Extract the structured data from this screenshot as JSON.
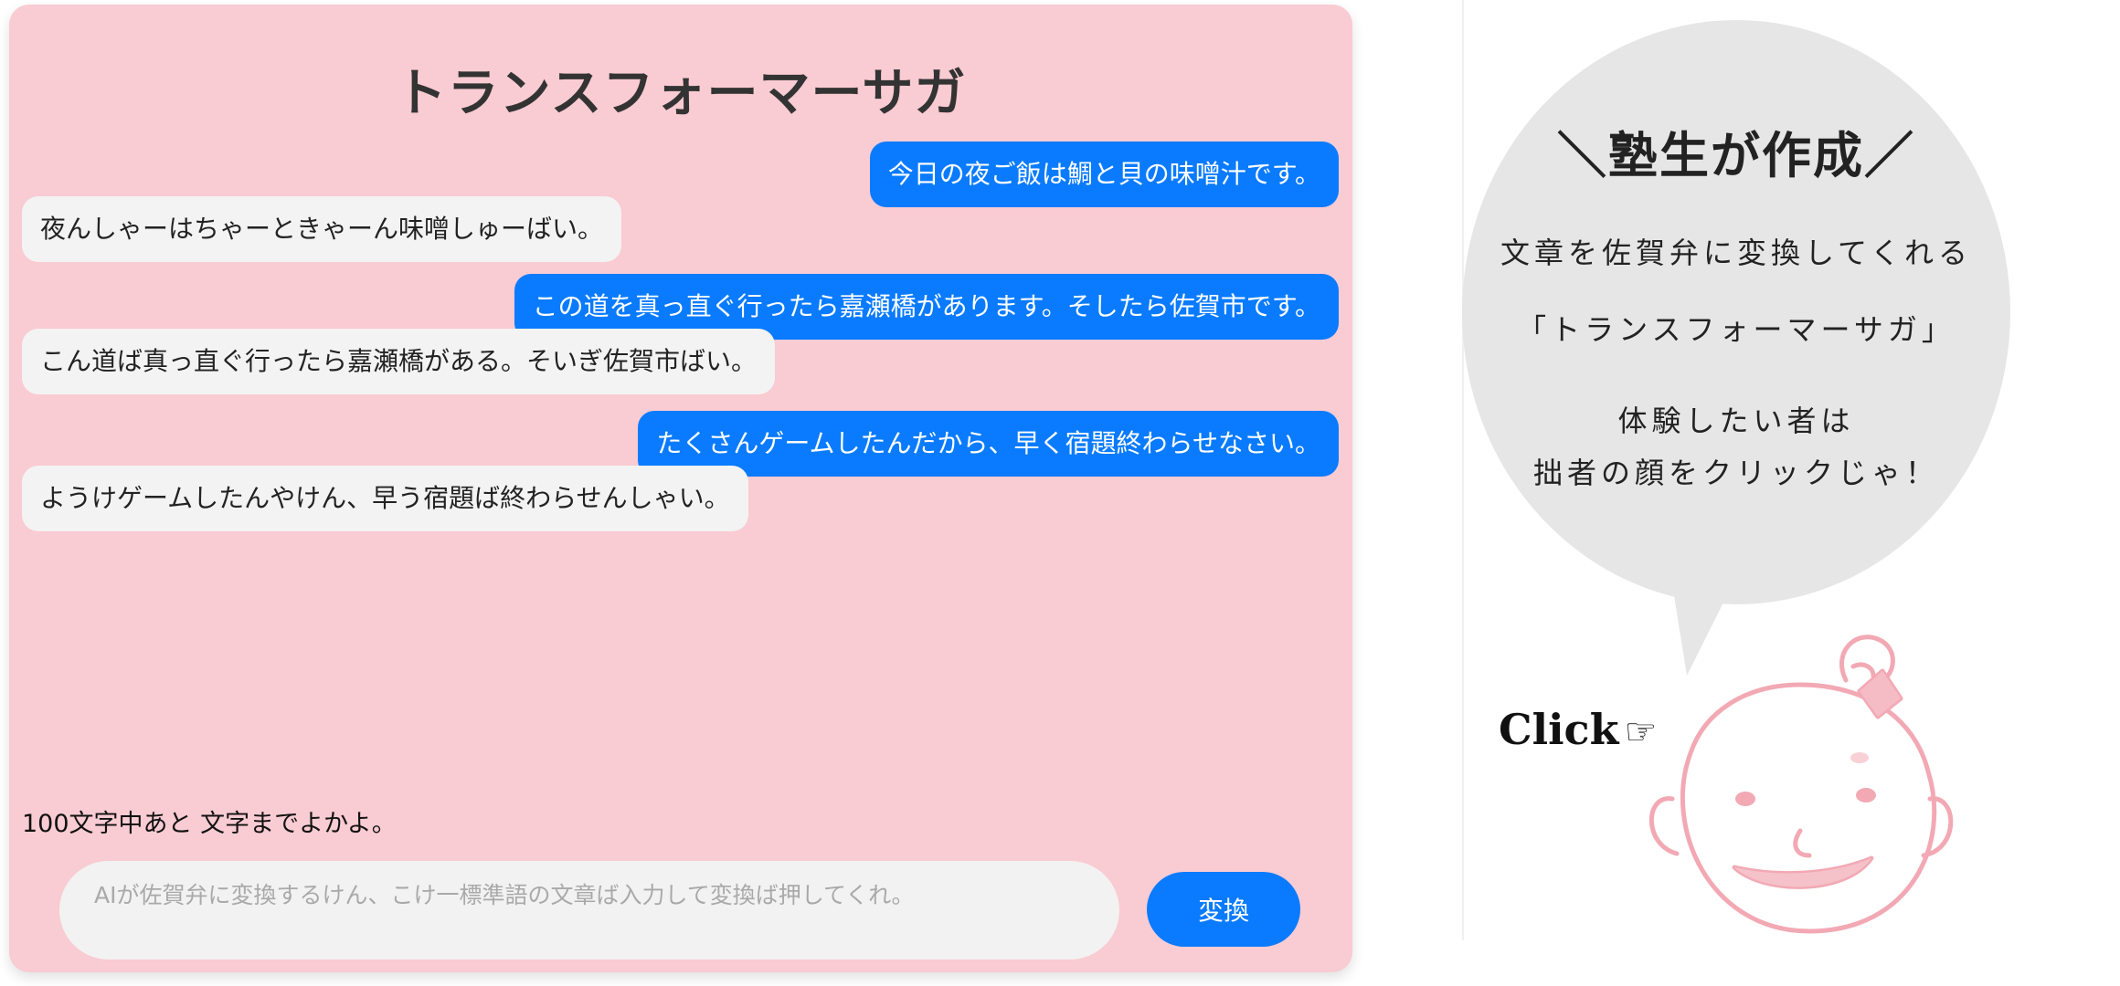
{
  "chat": {
    "title": "トランスフォーマーサガ",
    "messages": [
      {
        "role": "user",
        "text": "今日の夜ご飯は鯛と貝の味噌汁です。"
      },
      {
        "role": "bot",
        "text": "夜んしゃーはちゃーときゃーん味噌しゅーばい。"
      },
      {
        "role": "user",
        "text": "この道を真っ直ぐ行ったら嘉瀬橋があります。そしたら佐賀市です。"
      },
      {
        "role": "bot",
        "text": "こん道ば真っ直ぐ行ったら嘉瀬橋がある。そいぎ佐賀市ばい。"
      },
      {
        "role": "user",
        "text": "たくさんゲームしたんだから、早く宿題終わらせなさい。"
      },
      {
        "role": "bot",
        "text": "ようけゲームしたんやけん、早う宿題ば終わらせんしゃい。"
      }
    ],
    "counter_text": "100文字中あと 文字までよかよ。",
    "input": {
      "value": "",
      "placeholder": "AIが佐賀弁に変換するけん、こけ一標準語の文章ば入力して変換ば押してくれ。"
    },
    "convert_label": "変換"
  },
  "promo": {
    "heading": "＼塾生が作成／",
    "line1": "文章を佐賀弁に変換してくれる",
    "line2": "「トランスフォーマーサガ」",
    "line3": "体験したい者は",
    "line4": "拙者の顔をクリックじゃ！",
    "click_label": "Click",
    "click_icon": "☞"
  },
  "colors": {
    "panel_bg": "#f9cbd2",
    "user_bubble": "#0a7bff",
    "bot_bubble": "#f3f3f3",
    "speech_bubble": "#e6e6e6",
    "mascot_line": "#f2a9b4"
  }
}
